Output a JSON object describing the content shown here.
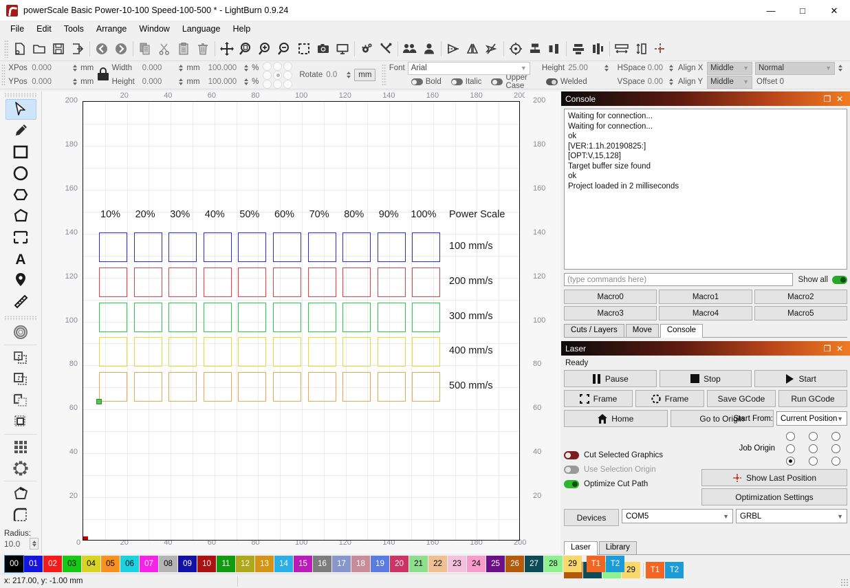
{
  "window": {
    "title": "powerScale Basic Power-10-100 Speed-100-500 * - LightBurn 0.9.24",
    "minimize": "—",
    "maximize": "□",
    "close": "✕"
  },
  "menu": [
    "File",
    "Edit",
    "Tools",
    "Arrange",
    "Window",
    "Language",
    "Help"
  ],
  "toolbar": {
    "groups": [
      [
        "new-file-icon",
        "open-folder-icon",
        "save-icon",
        "export-icon"
      ],
      [
        "undo-icon",
        "redo-icon"
      ],
      [
        "copy-icon",
        "cut-icon",
        "paste-icon",
        "delete-icon"
      ],
      [
        "move-icon",
        "zoom-fit-icon",
        "zoom-in-icon",
        "zoom-out-icon",
        "zoom-selection-icon",
        "camera-icon",
        "preview-icon"
      ],
      [
        "device-settings-icon",
        "machine-settings-icon"
      ],
      [
        "group-icon",
        "ungroup-icon"
      ],
      [
        "flip-horizontal-icon",
        "flip-vertical-icon",
        "close-path-icon"
      ],
      [
        "set-origin-icon",
        "align-h-icon",
        "align-v-icon"
      ],
      [
        "distribute-h-icon",
        "distribute-v-icon"
      ],
      [
        "spacing-h-icon",
        "spacing-v-icon",
        "center-icon"
      ]
    ]
  },
  "properties": {
    "xpos_label": "XPos",
    "xpos_value": "0.000",
    "ypos_label": "YPos",
    "ypos_value": "0.000",
    "pos_unit": "mm",
    "width_label": "Width",
    "width_value": "0.000",
    "height_label": "Height",
    "height_value": "0.000",
    "size_unit": "mm",
    "width_pct": "100.000",
    "height_pct": "100.000",
    "pct_unit": "%",
    "rotate_label": "Rotate",
    "rotate_value": "0.0",
    "unit_button": "mm",
    "font_label": "Font",
    "font_value": "Arial",
    "text_height_label": "Height",
    "text_height_value": "25.00",
    "hspace_label": "HSpace",
    "hspace_value": "0.00",
    "vspace_label": "VSpace",
    "vspace_value": "0.00",
    "align_x_label": "Align X",
    "align_x_value": "Middle",
    "align_y_label": "Align Y",
    "align_y_value": "Middle",
    "style_value": "Normal",
    "offset_label": "Offset 0",
    "bold_label": "Bold",
    "italic_label": "Italic",
    "upper_case_label": "Upper Case",
    "welded_label": "Welded"
  },
  "left_tools": {
    "items": [
      {
        "name": "select-tool",
        "selected": true
      },
      {
        "name": "draw-pen-tool",
        "selected": false
      },
      {
        "name": "rectangle-tool",
        "selected": false
      },
      {
        "name": "ellipse-tool",
        "selected": false
      },
      {
        "name": "polygon-tool",
        "selected": false
      },
      {
        "name": "pentagon-tool",
        "selected": false
      },
      {
        "name": "bracket-tool",
        "selected": false
      },
      {
        "name": "text-tool",
        "selected": false
      },
      {
        "name": "position-marker-tool",
        "selected": false
      },
      {
        "name": "measure-tool",
        "selected": false
      },
      {
        "name": "offset-shapes-tool",
        "selected": false
      },
      {
        "name": "boolean-union-tool",
        "selected": false
      },
      {
        "name": "boolean-subtract-tool",
        "selected": false
      },
      {
        "name": "boolean-intersect-tool",
        "selected": false
      },
      {
        "name": "boolean-weld-tool",
        "selected": false
      },
      {
        "name": "grid-array-tool",
        "selected": false
      },
      {
        "name": "circular-array-tool",
        "selected": false
      },
      {
        "name": "edit-nodes-tool",
        "selected": false
      },
      {
        "name": "fillet-radius-tool",
        "selected": false
      }
    ],
    "radius_label": "Radius:",
    "radius_value": "10.0"
  },
  "canvas": {
    "ruler_ticks_x": [
      0,
      20,
      40,
      60,
      80,
      100,
      120,
      140,
      160,
      180,
      200
    ],
    "ruler_ticks_y": [
      0,
      20,
      40,
      60,
      80,
      100,
      120,
      140,
      160,
      180,
      200
    ],
    "power_headers": [
      "10%",
      "20%",
      "30%",
      "40%",
      "50%",
      "60%",
      "70%",
      "80%",
      "90%",
      "100%"
    ],
    "power_scale_title": "Power Scale",
    "speed_rows": [
      {
        "label": "100 mm/s",
        "color": "#2b2bd8"
      },
      {
        "label": "200 mm/s",
        "color": "#ef3b3b"
      },
      {
        "label": "300 mm/s",
        "color": "#2bc94a"
      },
      {
        "label": "400 mm/s",
        "color": "#e3de34"
      },
      {
        "label": "500 mm/s",
        "color": "#f9a24a"
      }
    ]
  },
  "console": {
    "title": "Console",
    "maximize_icon": "❐",
    "close_icon": "✕",
    "lines": [
      "Waiting for connection...",
      "Waiting for connection...",
      "ok",
      "[VER:1.1h.20190825:]",
      "[OPT:V,15,128]",
      "Target buffer size found",
      "ok",
      "Project loaded in 2 milliseconds"
    ],
    "input_placeholder": "(type commands here)",
    "show_all_label": "Show all",
    "macros": [
      "Macro0",
      "Macro1",
      "Macro2",
      "Macro3",
      "Macro4",
      "Macro5"
    ],
    "tabs": [
      {
        "label": "Cuts / Layers",
        "active": false
      },
      {
        "label": "Move",
        "active": false
      },
      {
        "label": "Console",
        "active": true
      }
    ]
  },
  "laser": {
    "title": "Laser",
    "maximize_icon": "❐",
    "close_icon": "✕",
    "status": "Ready",
    "pause_label": "Pause",
    "stop_label": "Stop",
    "start_label": "Start",
    "frame_label": "Frame",
    "round_frame_label": "Frame",
    "save_gcode_label": "Save GCode",
    "run_gcode_label": "Run GCode",
    "home_label": "Home",
    "go_to_origin_label": "Go to Origin",
    "start_from_label": "Start From:",
    "start_from_value": "Current Position",
    "job_origin_label": "Job Origin",
    "job_origin_selected_index": 6,
    "cut_selected_label": "Cut Selected Graphics",
    "use_selection_origin_label": "Use Selection Origin",
    "optimize_cut_path_label": "Optimize Cut Path",
    "show_last_position_label": "Show Last Position",
    "optimization_settings_label": "Optimization Settings",
    "devices_label": "Devices",
    "port_value": "COM5",
    "protocol_value": "GRBL",
    "tabs": [
      {
        "label": "Laser",
        "active": true
      },
      {
        "label": "Library",
        "active": false
      }
    ]
  },
  "palette": {
    "swatches": [
      {
        "id": "00",
        "bg": "#000000",
        "fg": "#ffffff",
        "selected": true
      },
      {
        "id": "01",
        "bg": "#1515e0",
        "fg": "#ffffff"
      },
      {
        "id": "02",
        "bg": "#f51b1b",
        "fg": "#ffffff"
      },
      {
        "id": "03",
        "bg": "#16c916",
        "fg": "#000000"
      },
      {
        "id": "04",
        "bg": "#d9d424",
        "fg": "#000000"
      },
      {
        "id": "05",
        "bg": "#f7921e",
        "fg": "#000000"
      },
      {
        "id": "06",
        "bg": "#1ad2e0",
        "fg": "#000000"
      },
      {
        "id": "07",
        "bg": "#f423e8",
        "fg": "#ffffff"
      },
      {
        "id": "08",
        "bg": "#b4b4b4",
        "fg": "#000000"
      },
      {
        "id": "09",
        "bg": "#1111a8",
        "fg": "#ffffff"
      },
      {
        "id": "10",
        "bg": "#ad1111",
        "fg": "#ffffff"
      },
      {
        "id": "11",
        "bg": "#109b10",
        "fg": "#ffffff"
      },
      {
        "id": "12",
        "bg": "#afa81a",
        "fg": "#ffffff"
      },
      {
        "id": "13",
        "bg": "#d59416",
        "fg": "#ffffff"
      },
      {
        "id": "14",
        "bg": "#2bafe8",
        "fg": "#ffffff"
      },
      {
        "id": "15",
        "bg": "#bb1bbb",
        "fg": "#ffffff"
      },
      {
        "id": "16",
        "bg": "#7d7d7d",
        "fg": "#ffffff"
      },
      {
        "id": "17",
        "bg": "#8897c9",
        "fg": "#ffffff"
      },
      {
        "id": "18",
        "bg": "#c78b99",
        "fg": "#ffffff"
      },
      {
        "id": "19",
        "bg": "#5a7ce2",
        "fg": "#ffffff"
      },
      {
        "id": "20",
        "bg": "#cc3366",
        "fg": "#ffffff"
      },
      {
        "id": "21",
        "bg": "#8ede8e",
        "fg": "#000000"
      },
      {
        "id": "22",
        "bg": "#eec092",
        "fg": "#000000"
      },
      {
        "id": "23",
        "bg": "#f4c1dd",
        "fg": "#000000"
      },
      {
        "id": "24",
        "bg": "#f79ccd",
        "fg": "#000000"
      },
      {
        "id": "25",
        "bg": "#6b1088",
        "fg": "#ffffff"
      },
      {
        "id": "26",
        "bg": "#b55a0b",
        "fg": "#ffffff"
      },
      {
        "id": "27",
        "bg": "#0d4b57",
        "fg": "#ffffff"
      },
      {
        "id": "28",
        "bg": "#8ef291",
        "fg": "#000000"
      },
      {
        "id": "29",
        "bg": "#f9d96a",
        "fg": "#000000"
      },
      {
        "id": "T1",
        "bg": "#f26522",
        "fg": "#ffffff"
      },
      {
        "id": "T2",
        "bg": "#1b9bd8",
        "fg": "#ffffff"
      }
    ]
  },
  "status": {
    "coords": "x: 217.00, y: -1.00 mm"
  }
}
